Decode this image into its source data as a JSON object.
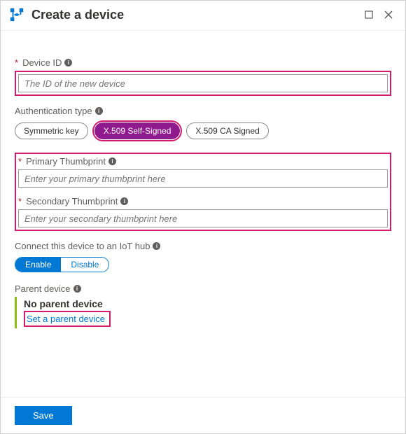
{
  "header": {
    "title": "Create a device"
  },
  "deviceId": {
    "label": "Device ID",
    "placeholder": "The ID of the new device"
  },
  "authType": {
    "label": "Authentication type",
    "options": {
      "symmetric": "Symmetric key",
      "selfSigned": "X.509 Self-Signed",
      "caSigned": "X.509 CA Signed"
    }
  },
  "thumbprints": {
    "primaryLabel": "Primary Thumbprint",
    "primaryPlaceholder": "Enter your primary thumbprint here",
    "secondaryLabel": "Secondary Thumbprint",
    "secondaryPlaceholder": "Enter your secondary thumbprint here"
  },
  "connect": {
    "label": "Connect this device to an IoT hub",
    "enable": "Enable",
    "disable": "Disable"
  },
  "parent": {
    "label": "Parent device",
    "status": "No parent device",
    "setLink": "Set a parent device"
  },
  "footer": {
    "save": "Save"
  }
}
